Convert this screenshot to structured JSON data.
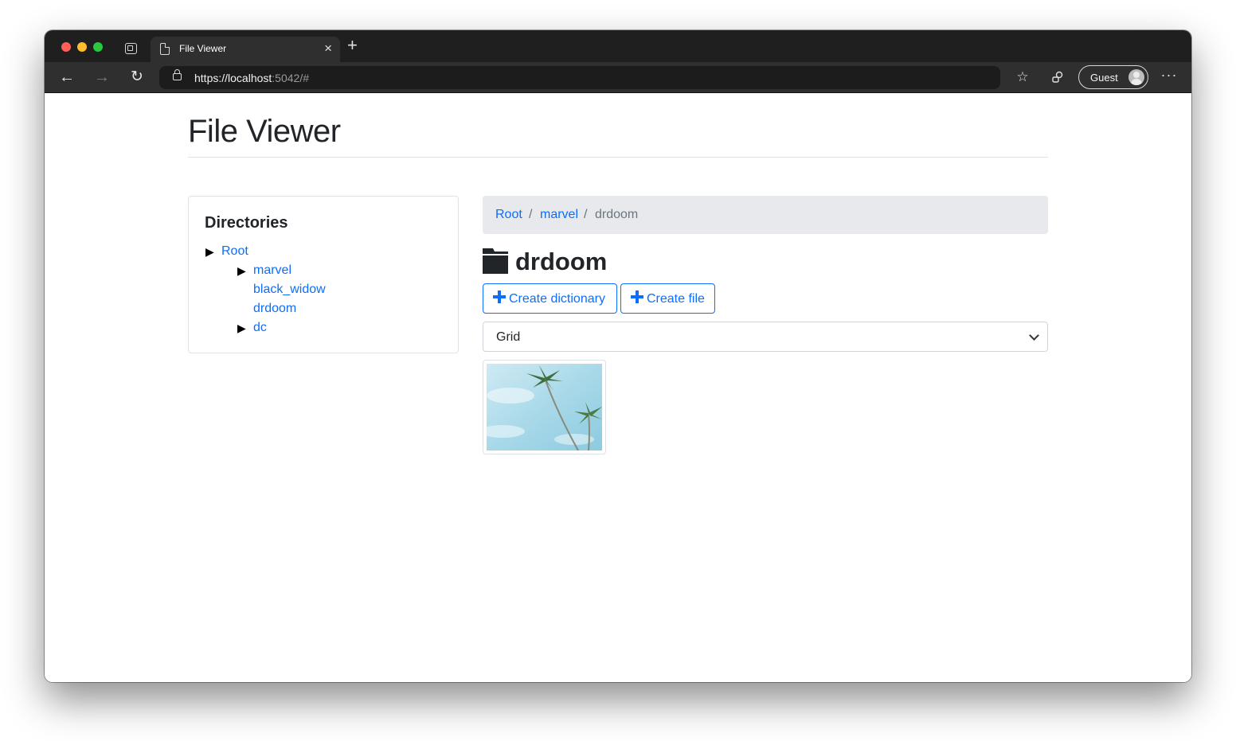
{
  "browser": {
    "tab_title": "File Viewer",
    "tab_close": "×",
    "new_tab": "+",
    "url_main": "https://localhost",
    "url_dim": ":5042/#",
    "profile_label": "Guest",
    "back_icon": "←",
    "forward_icon": "→",
    "reload_icon": "↻",
    "favorites_icon": "☆",
    "more_icon": "···"
  },
  "page": {
    "title": "File Viewer"
  },
  "directories": {
    "heading": "Directories",
    "caret": "▶",
    "items": [
      {
        "label": "Root",
        "expanded": true
      },
      {
        "label": "marvel",
        "expanded": true
      },
      {
        "label": "black_widow",
        "expanded": false
      },
      {
        "label": "drdoom",
        "expanded": false
      },
      {
        "label": "dc",
        "expanded": true
      }
    ]
  },
  "breadcrumb": {
    "items": [
      "Root",
      "marvel",
      "drdoom"
    ],
    "separator": "/"
  },
  "folder": {
    "name": "drdoom"
  },
  "actions": {
    "create_dictionary": "Create dictionary",
    "create_file": "Create file"
  },
  "view_select": {
    "value": "Grid"
  },
  "colors": {
    "link": "#0d6efd",
    "breadcrumb_bg": "#e7e9ec",
    "browser_chrome": "#1f1f1f"
  },
  "files": [
    {
      "kind": "image",
      "subject": "palm trees against sky"
    }
  ]
}
